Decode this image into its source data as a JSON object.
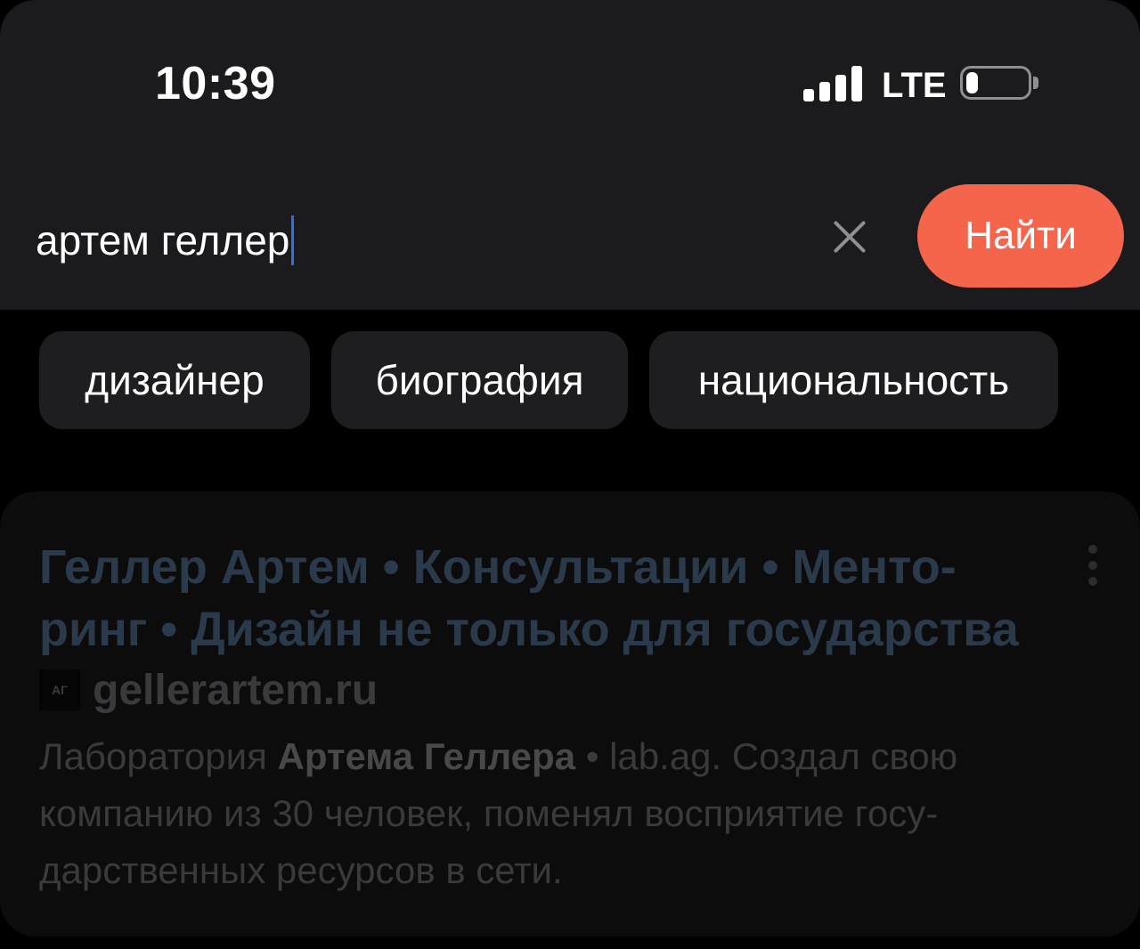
{
  "status_bar": {
    "time": "10:39",
    "network": "LTE",
    "battery_level": 0.2
  },
  "search": {
    "query": "артем геллер",
    "clear_icon": "close-icon",
    "submit_label": "Найти",
    "accent_color": "#f5654c"
  },
  "suggestions": [
    {
      "label": "дизайнер"
    },
    {
      "label": "биография"
    },
    {
      "label": "национальность"
    }
  ],
  "result": {
    "title_line1": "Геллер Артем • Консультации • Менто-",
    "title_line2": "ринг • Дизайн не только для государства",
    "favicon_text": "АГ",
    "url": "gellerartem.ru",
    "snippet_part1": "Лаборатория ",
    "snippet_bold": "Артема Геллера",
    "snippet_part2": " • lab.ag. Создал свою компанию из 30 человек, поменял восприятие госу-дарственных ресурсов в сети."
  }
}
